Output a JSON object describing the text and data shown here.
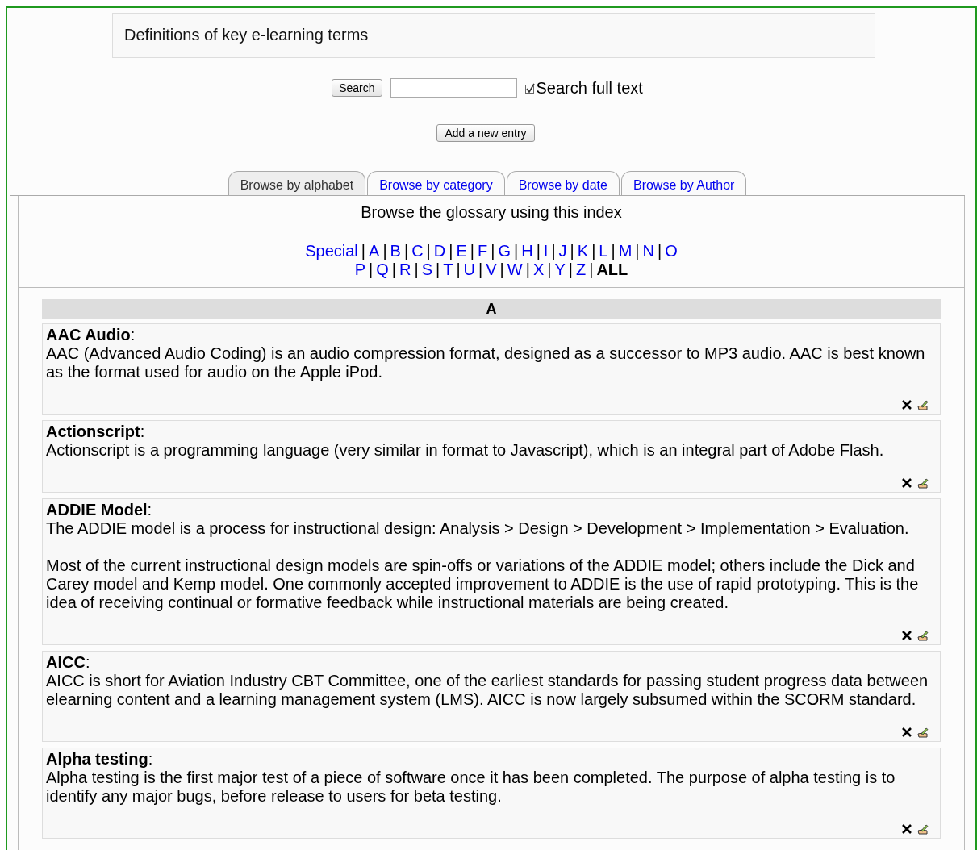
{
  "intro": "Definitions of key e-learning terms",
  "search": {
    "button": "Search",
    "full_text": {
      "label": "Search full text",
      "checked": true
    }
  },
  "add_button": "Add a new entry",
  "tabs": [
    {
      "label": "Browse by alphabet",
      "selected": true
    },
    {
      "label": "Browse by category",
      "selected": false
    },
    {
      "label": "Browse by date",
      "selected": false
    },
    {
      "label": "Browse by Author",
      "selected": false
    }
  ],
  "index": {
    "title": "Browse the glossary using this index",
    "separator": "|",
    "lines": [
      {
        "letters": [
          {
            "label": "Special",
            "selected": false
          },
          {
            "label": "A",
            "selected": false
          },
          {
            "label": "B",
            "selected": false
          },
          {
            "label": "C",
            "selected": false
          },
          {
            "label": "D",
            "selected": false
          },
          {
            "label": "E",
            "selected": false
          },
          {
            "label": "F",
            "selected": false
          },
          {
            "label": "G",
            "selected": false
          },
          {
            "label": "H",
            "selected": false
          },
          {
            "label": "I",
            "selected": false
          },
          {
            "label": "J",
            "selected": false
          },
          {
            "label": "K",
            "selected": false
          },
          {
            "label": "L",
            "selected": false
          },
          {
            "label": "M",
            "selected": false
          },
          {
            "label": "N",
            "selected": false
          },
          {
            "label": "O",
            "selected": false
          }
        ]
      },
      {
        "letters": [
          {
            "label": "P",
            "selected": false
          },
          {
            "label": "Q",
            "selected": false
          },
          {
            "label": "R",
            "selected": false
          },
          {
            "label": "S",
            "selected": false
          },
          {
            "label": "T",
            "selected": false
          },
          {
            "label": "U",
            "selected": false
          },
          {
            "label": "V",
            "selected": false
          },
          {
            "label": "W",
            "selected": false
          },
          {
            "label": "X",
            "selected": false
          },
          {
            "label": "Y",
            "selected": false
          },
          {
            "label": "Z",
            "selected": false
          },
          {
            "label": "ALL",
            "selected": true
          }
        ]
      }
    ]
  },
  "section": "A",
  "entries": [
    {
      "term": "**AAC Audio**:",
      "paragraphs": [
        "AAC (Advanced Audio Coding) is an audio compression format, designed as a successor to MP3 audio. AAC is best known as the format used for audio on the Apple iPod."
      ]
    },
    {
      "term": "**Actionscript**:",
      "paragraphs": [
        "Actionscript is a programming language (very similar in format to Javascript), which is an integral part of Adobe Flash."
      ]
    },
    {
      "term": "**ADDIE Model**:",
      "paragraphs": [
        "The ADDIE model is a process for instructional design: Analysis > Design > Development > Implementation > Evaluation.",
        "Most of the current instructional design models are spin-offs or variations of the ADDIE model; others include the Dick and Carey model and Kemp model. One commonly accepted improvement to ADDIE is the use of rapid prototyping. This is the idea of receiving continual or formative feedback while instructional materials are being created."
      ]
    },
    {
      "term": "**AICC**:",
      "paragraphs": [
        "AICC is short for Aviation Industry CBT Committee, one of the earliest standards for passing student progress data between elearning content and a learning management system (LMS). AICC is now largely subsumed within the SCORM standard."
      ]
    },
    {
      "term": "**Alpha testing**:",
      "paragraphs": [
        "Alpha testing is the first major test of a piece of software once it has been completed. The purpose of alpha testing is to identify any major bugs, before release to users for beta testing."
      ]
    }
  ]
}
